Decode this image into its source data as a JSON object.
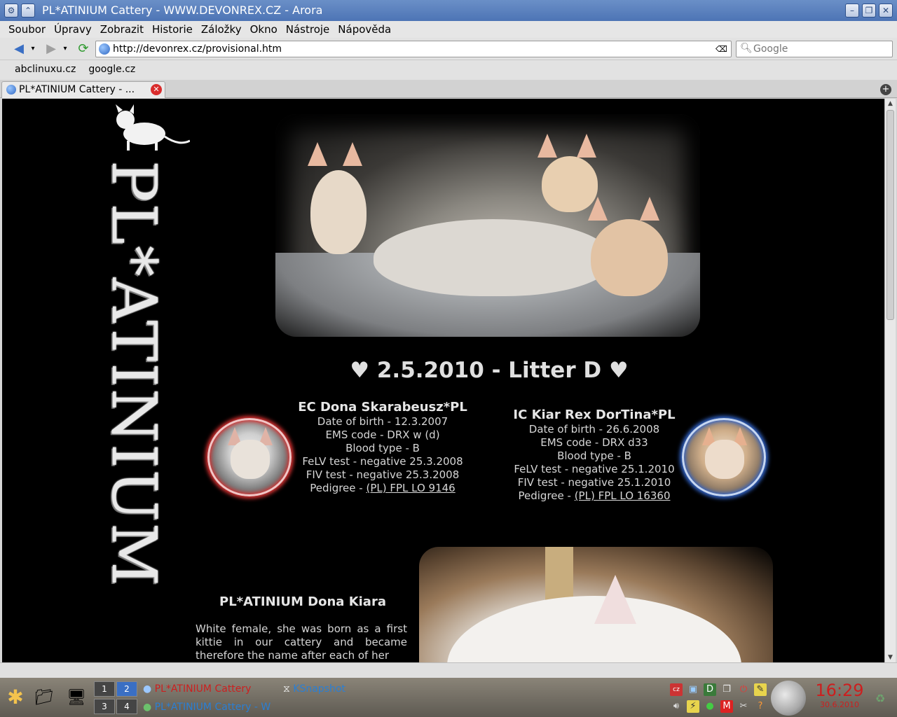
{
  "window": {
    "title": "PL*ATINIUM Cattery - WWW.DEVONREX.CZ - Arora"
  },
  "menu": [
    "Soubor",
    "Úpravy",
    "Zobrazit",
    "Historie",
    "Záložky",
    "Okno",
    "Nástroje",
    "Nápověda"
  ],
  "navbar": {
    "url": "http://devonrex.cz/provisional.htm",
    "search_placeholder": "Google"
  },
  "bookmarks": [
    "abclinuxu.cz",
    "google.cz"
  ],
  "tabs": [
    {
      "label": "PL*ATINIUM Cattery - ..."
    }
  ],
  "page": {
    "logo_text": "PL*ATINIUM",
    "litter_title": "♥ 2.5.2010 - Litter D ♥",
    "mother": {
      "name": "EC Dona Skarabeusz*PL",
      "dob": "Date of birth - 12.3.2007",
      "ems": "EMS code - DRX w (d)",
      "blood": "Blood type - B",
      "felv": "FeLV test - negative 25.3.2008",
      "fiv": "FIV test - negative 25.3.2008",
      "pedigree_prefix": "Pedigree - ",
      "pedigree_link": "(PL) FPL LO 9146"
    },
    "father": {
      "name": "IC Kiar Rex DorTina*PL",
      "dob": "Date of birth - 26.6.2008",
      "ems": "EMS code - DRX d33",
      "blood": "Blood type - B",
      "felv": "FeLV test - negative 25.1.2010",
      "fiv": "FIV test - negative 25.1.2010",
      "pedigree_prefix": "Pedigree - ",
      "pedigree_link": "(PL) FPL LO 16360"
    },
    "kitten_title": "PL*ATINIUM Dona Kiara",
    "kitten_desc": "White female, she was born as a first kittie in our cattery and became therefore the name after each of her"
  },
  "taskbar": {
    "pager": [
      "1",
      "2",
      "3",
      "4"
    ],
    "tasks": [
      {
        "label": "PL*ATINIUM Cattery",
        "color": "#cc1f1f"
      },
      {
        "label": "KSnapshot",
        "color": "#2a7fd4"
      },
      {
        "label": "PL*ATINIUM Cattery - W",
        "color": "#2a7fd4"
      }
    ],
    "time": "16:29",
    "date": "30.6.2010"
  }
}
